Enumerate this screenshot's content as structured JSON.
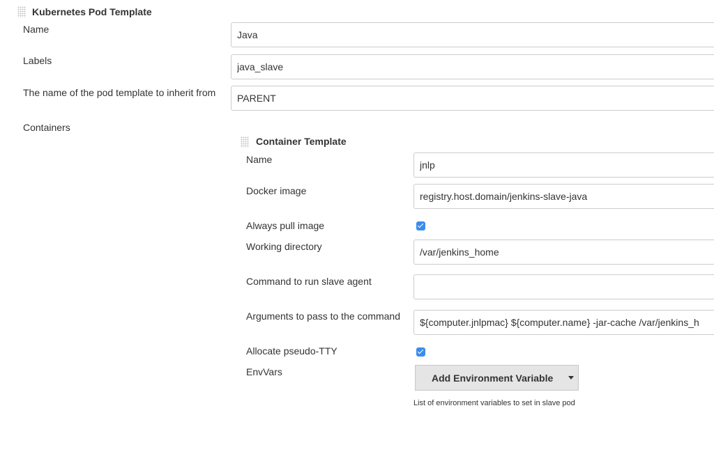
{
  "pod_template": {
    "title": "Kubernetes Pod Template",
    "name_label": "Name",
    "name_value": "Java",
    "labels_label": "Labels",
    "labels_value": "java_slave",
    "inherit_label": "The name of the pod template to inherit from",
    "inherit_value": "PARENT",
    "containers_label": "Containers"
  },
  "container_template": {
    "title": "Container Template",
    "name_label": "Name",
    "name_value": "jnlp",
    "docker_image_label": "Docker image",
    "docker_image_value": "registry.host.domain/jenkins-slave-java",
    "always_pull_label": "Always pull image",
    "always_pull_checked": true,
    "working_dir_label": "Working directory",
    "working_dir_value": "/var/jenkins_home",
    "command_label": "Command to run slave agent",
    "command_value": "",
    "arguments_label": "Arguments to pass to the command",
    "arguments_value": "${computer.jnlpmac} ${computer.name} -jar-cache /var/jenkins_h",
    "tty_label": "Allocate pseudo-TTY",
    "tty_checked": true,
    "envvars_label": "EnvVars",
    "add_env_button": "Add Environment Variable",
    "envvars_help": "List of environment variables to set in slave pod"
  },
  "colors": {
    "checkbox": "#3b8ded",
    "button_bg": "#e5e5e5",
    "border": "#cccccc"
  }
}
